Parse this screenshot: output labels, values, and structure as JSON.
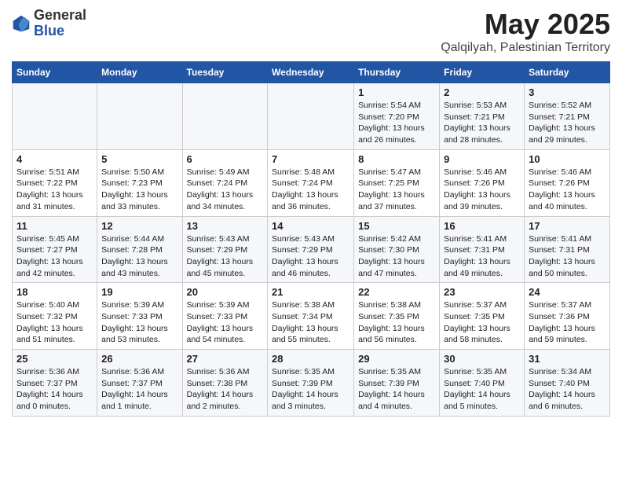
{
  "header": {
    "logo_general": "General",
    "logo_blue": "Blue",
    "month": "May 2025",
    "location": "Qalqilyah, Palestinian Territory"
  },
  "days_of_week": [
    "Sunday",
    "Monday",
    "Tuesday",
    "Wednesday",
    "Thursday",
    "Friday",
    "Saturday"
  ],
  "weeks": [
    [
      {
        "day": "",
        "content": ""
      },
      {
        "day": "",
        "content": ""
      },
      {
        "day": "",
        "content": ""
      },
      {
        "day": "",
        "content": ""
      },
      {
        "day": "1",
        "content": "Sunrise: 5:54 AM\nSunset: 7:20 PM\nDaylight: 13 hours\nand 26 minutes."
      },
      {
        "day": "2",
        "content": "Sunrise: 5:53 AM\nSunset: 7:21 PM\nDaylight: 13 hours\nand 28 minutes."
      },
      {
        "day": "3",
        "content": "Sunrise: 5:52 AM\nSunset: 7:21 PM\nDaylight: 13 hours\nand 29 minutes."
      }
    ],
    [
      {
        "day": "4",
        "content": "Sunrise: 5:51 AM\nSunset: 7:22 PM\nDaylight: 13 hours\nand 31 minutes."
      },
      {
        "day": "5",
        "content": "Sunrise: 5:50 AM\nSunset: 7:23 PM\nDaylight: 13 hours\nand 33 minutes."
      },
      {
        "day": "6",
        "content": "Sunrise: 5:49 AM\nSunset: 7:24 PM\nDaylight: 13 hours\nand 34 minutes."
      },
      {
        "day": "7",
        "content": "Sunrise: 5:48 AM\nSunset: 7:24 PM\nDaylight: 13 hours\nand 36 minutes."
      },
      {
        "day": "8",
        "content": "Sunrise: 5:47 AM\nSunset: 7:25 PM\nDaylight: 13 hours\nand 37 minutes."
      },
      {
        "day": "9",
        "content": "Sunrise: 5:46 AM\nSunset: 7:26 PM\nDaylight: 13 hours\nand 39 minutes."
      },
      {
        "day": "10",
        "content": "Sunrise: 5:46 AM\nSunset: 7:26 PM\nDaylight: 13 hours\nand 40 minutes."
      }
    ],
    [
      {
        "day": "11",
        "content": "Sunrise: 5:45 AM\nSunset: 7:27 PM\nDaylight: 13 hours\nand 42 minutes."
      },
      {
        "day": "12",
        "content": "Sunrise: 5:44 AM\nSunset: 7:28 PM\nDaylight: 13 hours\nand 43 minutes."
      },
      {
        "day": "13",
        "content": "Sunrise: 5:43 AM\nSunset: 7:29 PM\nDaylight: 13 hours\nand 45 minutes."
      },
      {
        "day": "14",
        "content": "Sunrise: 5:43 AM\nSunset: 7:29 PM\nDaylight: 13 hours\nand 46 minutes."
      },
      {
        "day": "15",
        "content": "Sunrise: 5:42 AM\nSunset: 7:30 PM\nDaylight: 13 hours\nand 47 minutes."
      },
      {
        "day": "16",
        "content": "Sunrise: 5:41 AM\nSunset: 7:31 PM\nDaylight: 13 hours\nand 49 minutes."
      },
      {
        "day": "17",
        "content": "Sunrise: 5:41 AM\nSunset: 7:31 PM\nDaylight: 13 hours\nand 50 minutes."
      }
    ],
    [
      {
        "day": "18",
        "content": "Sunrise: 5:40 AM\nSunset: 7:32 PM\nDaylight: 13 hours\nand 51 minutes."
      },
      {
        "day": "19",
        "content": "Sunrise: 5:39 AM\nSunset: 7:33 PM\nDaylight: 13 hours\nand 53 minutes."
      },
      {
        "day": "20",
        "content": "Sunrise: 5:39 AM\nSunset: 7:33 PM\nDaylight: 13 hours\nand 54 minutes."
      },
      {
        "day": "21",
        "content": "Sunrise: 5:38 AM\nSunset: 7:34 PM\nDaylight: 13 hours\nand 55 minutes."
      },
      {
        "day": "22",
        "content": "Sunrise: 5:38 AM\nSunset: 7:35 PM\nDaylight: 13 hours\nand 56 minutes."
      },
      {
        "day": "23",
        "content": "Sunrise: 5:37 AM\nSunset: 7:35 PM\nDaylight: 13 hours\nand 58 minutes."
      },
      {
        "day": "24",
        "content": "Sunrise: 5:37 AM\nSunset: 7:36 PM\nDaylight: 13 hours\nand 59 minutes."
      }
    ],
    [
      {
        "day": "25",
        "content": "Sunrise: 5:36 AM\nSunset: 7:37 PM\nDaylight: 14 hours\nand 0 minutes."
      },
      {
        "day": "26",
        "content": "Sunrise: 5:36 AM\nSunset: 7:37 PM\nDaylight: 14 hours\nand 1 minute."
      },
      {
        "day": "27",
        "content": "Sunrise: 5:36 AM\nSunset: 7:38 PM\nDaylight: 14 hours\nand 2 minutes."
      },
      {
        "day": "28",
        "content": "Sunrise: 5:35 AM\nSunset: 7:39 PM\nDaylight: 14 hours\nand 3 minutes."
      },
      {
        "day": "29",
        "content": "Sunrise: 5:35 AM\nSunset: 7:39 PM\nDaylight: 14 hours\nand 4 minutes."
      },
      {
        "day": "30",
        "content": "Sunrise: 5:35 AM\nSunset: 7:40 PM\nDaylight: 14 hours\nand 5 minutes."
      },
      {
        "day": "31",
        "content": "Sunrise: 5:34 AM\nSunset: 7:40 PM\nDaylight: 14 hours\nand 6 minutes."
      }
    ]
  ]
}
